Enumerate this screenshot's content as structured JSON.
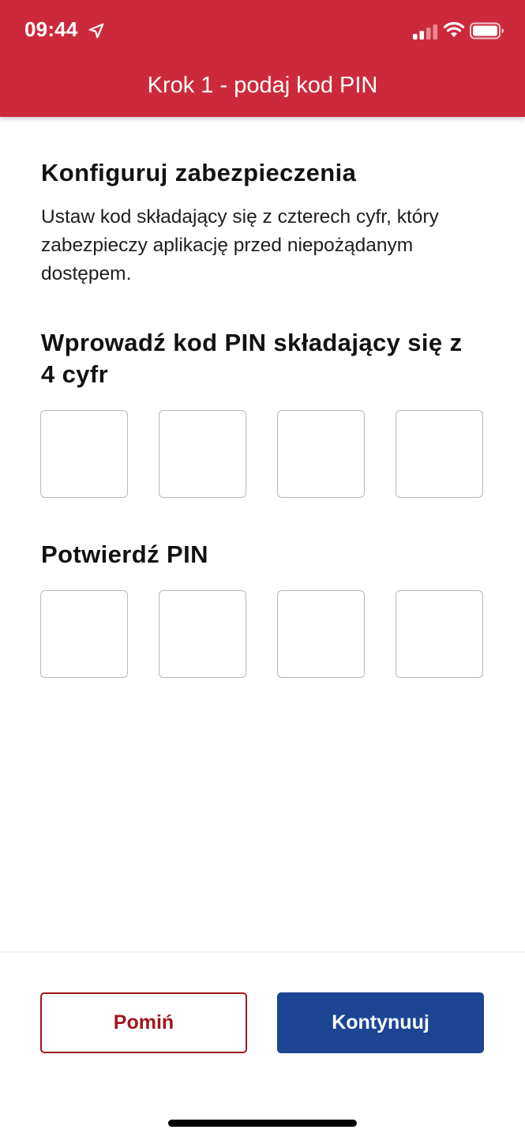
{
  "status_bar": {
    "time": "09:44",
    "icons": [
      "location-arrow-icon",
      "cellular-signal-icon",
      "wifi-icon",
      "battery-icon"
    ]
  },
  "header": {
    "title": "Krok 1 - podaj kod PIN",
    "background_color": "#cc2a3c"
  },
  "configure": {
    "title": "Konfiguruj zabezpieczenia",
    "description": "Ustaw kod składający się z czterech cyfr, który zabezpieczy aplikację przed niepożądanym dostępem."
  },
  "pin_entry": {
    "title": "Wprowadź kod PIN składający się z 4 cyfr",
    "digits": [
      "",
      "",
      "",
      ""
    ]
  },
  "pin_confirm": {
    "title": "Potwierdź PIN",
    "digits": [
      "",
      "",
      "",
      ""
    ]
  },
  "actions": {
    "skip_label": "Pomiń",
    "continue_label": "Kontynuuj",
    "skip_color": "#a0161c",
    "continue_color": "#1c4594"
  }
}
